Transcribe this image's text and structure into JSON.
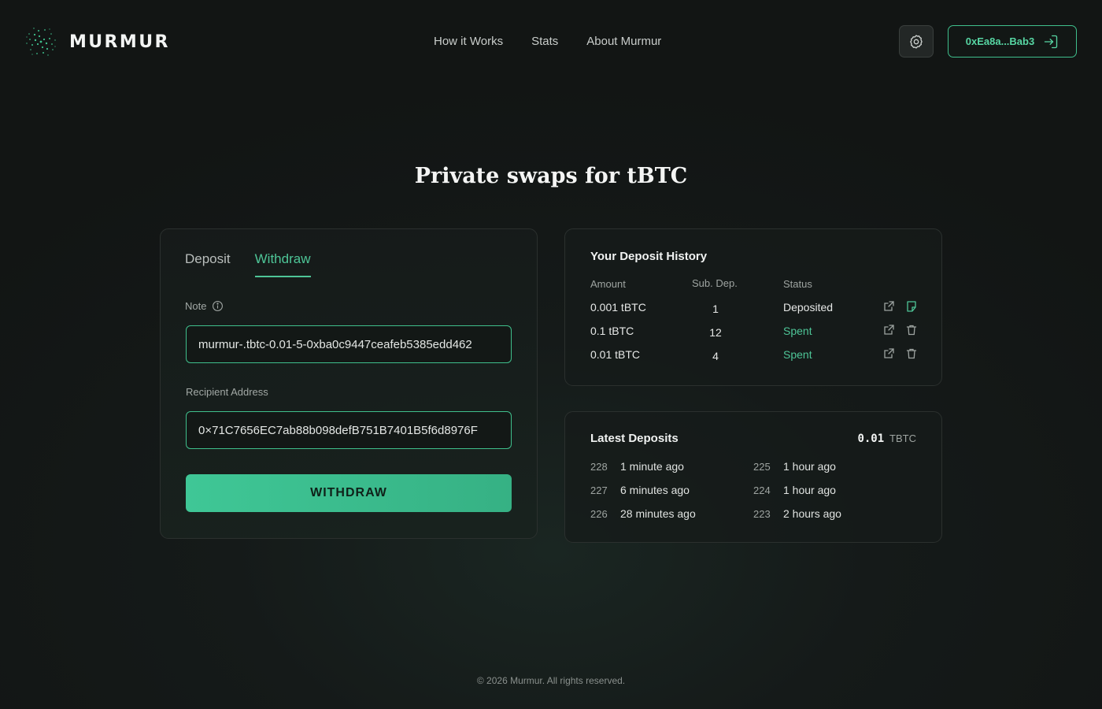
{
  "brand": {
    "name": "MURMUR"
  },
  "nav": {
    "items": [
      "How it Works",
      "Stats",
      "About Murmur"
    ]
  },
  "wallet": {
    "address": "0xEa8a...Bab3"
  },
  "hero": {
    "title": "Private swaps for tBTC"
  },
  "form": {
    "tabs": [
      "Deposit",
      "Withdraw"
    ],
    "active_tab": "Withdraw",
    "note_label": "Note",
    "note_value": "murmur-.tbtc-0.01-5-0xba0c9447ceafeb5385edd462",
    "recipient_label": "Recipient Address",
    "recipient_value": "0×71C7656EC7ab88b098defB751B7401B5f6d8976F",
    "submit_label": "WITHDRAW"
  },
  "history": {
    "title": "Your Deposit History",
    "columns": [
      "Amount",
      "Sub. Dep.",
      "Status"
    ],
    "rows": [
      {
        "amount": "0.001 tBTC",
        "sub": "1",
        "status": "Deposited"
      },
      {
        "amount": "0.1 tBTC",
        "sub": "12",
        "status": "Spent"
      },
      {
        "amount": "0.01 tBTC",
        "sub": "4",
        "status": "Spent"
      }
    ]
  },
  "latest": {
    "title": "Latest Deposits",
    "amount": "0.01",
    "unit": "TBTC",
    "items": [
      {
        "id": "228",
        "time": "1 minute ago"
      },
      {
        "id": "227",
        "time": "6 minutes ago"
      },
      {
        "id": "226",
        "time": "28 minutes ago"
      },
      {
        "id": "225",
        "time": "1 hour ago"
      },
      {
        "id": "224",
        "time": "1 hour ago"
      },
      {
        "id": "223",
        "time": "2 hours ago"
      }
    ]
  },
  "footer": {
    "text": "© 2026 Murmur. All rights reserved."
  },
  "colors": {
    "accent": "#4ec597",
    "background": "#151a19",
    "card_border": "#2b302e"
  }
}
